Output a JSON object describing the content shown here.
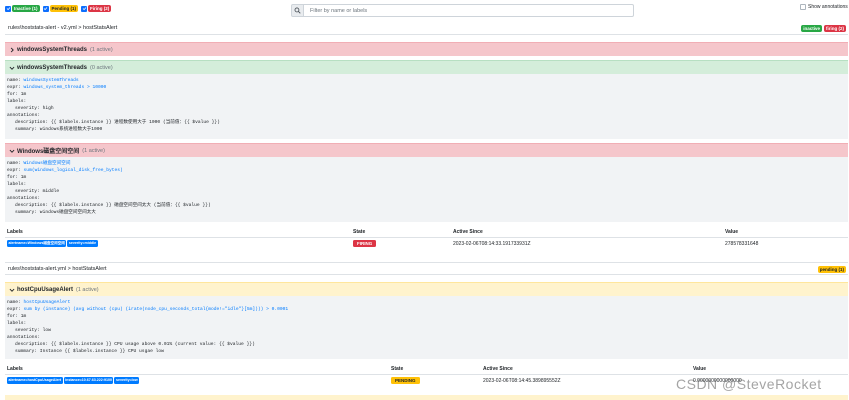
{
  "filters": {
    "inactive": "Inactive (1)",
    "pending": "Pending (1)",
    "firing": "Firing (2)"
  },
  "search": {
    "placeholder": "Filter by name or labels"
  },
  "show_annotations": "Show annotations",
  "group1": {
    "path": "rules\\hoststats-alert - v2.yml > hostStatsAlert",
    "badges": {
      "inactive": "inactive",
      "firing": "firing (2)"
    },
    "rules": [
      {
        "name": "windowsSystemThreads",
        "count": "(1 active)",
        "collapsed": true
      },
      {
        "name": "windowsSystemThreads",
        "count": "(0 active)",
        "body": {
          "name_key": "name: ",
          "name_val": "windowsSystemThreads",
          "expr_key": "expr: ",
          "expr_val": "windows_system_threads > 10000",
          "for": "for: 1m",
          "labels": "labels:",
          "severity": "severity: high",
          "annotations": "annotations:",
          "description": "description: {{ $labels.instance }} 进程数使用大于 1000 (当前值：{{ $value }})",
          "summary": "summary: windows系统进程数大于1000"
        }
      },
      {
        "name": "Windows磁盘空间空间",
        "count": "(1 active)",
        "body": {
          "name_key": "name: ",
          "name_val": "Windows磁盘空间空间",
          "expr_key": "expr: ",
          "expr_val": "sum(windows_logical_disk_free_bytes)",
          "for": "for: 1m",
          "labels": "labels:",
          "severity": "severity: middle",
          "annotations": "annotations:",
          "description": "description: {{ $labels.instance }} 磁盘空间空间太大 (当前值：{{ $value }})",
          "summary": "summary: windows磁盘空间空间太大"
        },
        "table": {
          "headers": [
            "Labels",
            "State",
            "Active Since",
            "Value"
          ],
          "row": {
            "labels": [
              "alertname=Windows磁盘空间空间",
              "severity=middle"
            ],
            "state": "FIRING",
            "active_since": "2023-02-06T08:14:33.191733931Z",
            "value": "278578331648"
          }
        }
      }
    ]
  },
  "group2": {
    "path": "rules\\hoststats-alert.yml > hostStatsAlert",
    "badges": {
      "pending": "pending (1)"
    },
    "rule": {
      "name": "hostCpuUsageAlert",
      "count": "(1 active)",
      "body": {
        "name_key": "name: ",
        "name_val": "hostCpuUsageAlert",
        "expr_key": "expr: ",
        "expr_val": "sum by (instance) (avg without (cpu) (irate(node_cpu_seconds_total{mode!=\"idle\"}[5m]))) > 0.0001",
        "for": "for: 1m",
        "labels": "labels:",
        "severity": "severity: low",
        "annotations": "annotations:",
        "description": "description: {{ $labels.instance }} CPU usage above 0.01% (current value: {{ $value }})",
        "summary": "summary: Instance {{ $labels.instance }} CPU usgae low"
      },
      "table": {
        "headers": [
          "Labels",
          "State",
          "Active Since",
          "Value"
        ],
        "row": {
          "labels": [
            "alertname=hostCpuUsageAlert",
            "instance=10.67.63.222:9100",
            "severity=low"
          ],
          "state": "PENDING",
          "active_since": "2023-02-06T08:14:45.389895552Z",
          "value": "0.0000000000000000"
        }
      }
    }
  },
  "watermark": "CSDN @SteveRocket"
}
